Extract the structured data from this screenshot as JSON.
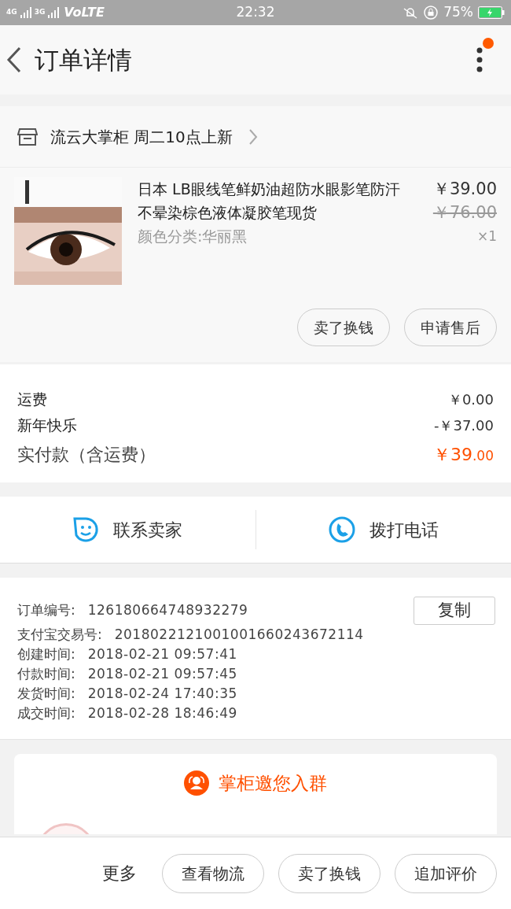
{
  "status_bar": {
    "network_1": "4G",
    "network_2": "3G",
    "volte": "VoLTE",
    "time": "22:32",
    "battery": "75%"
  },
  "header": {
    "title": "订单详情",
    "has_notification": true
  },
  "shop": {
    "name": "流云大掌柜 周二10点上新"
  },
  "product": {
    "title": "日本 LB眼线笔鲜奶油超防水眼影笔防汗不晕染棕色液体凝胶笔现货",
    "variant": "颜色分类:华丽黑",
    "price": "￥39.00",
    "original_price": "￥76.00",
    "quantity": "×1"
  },
  "product_actions": [
    "卖了换钱",
    "申请售后"
  ],
  "fees": [
    {
      "label": "运费",
      "value": "￥0.00",
      "kind": "normal"
    },
    {
      "label": "新年快乐",
      "value": "-￥37.00",
      "kind": "normal"
    },
    {
      "label": "实付款（含运费）",
      "value": "￥39",
      "value_cents": ".00",
      "kind": "total"
    }
  ],
  "contact": [
    {
      "label": "联系卖家",
      "kind": "chat"
    },
    {
      "label": "拨打电话",
      "kind": "phone"
    }
  ],
  "order_info": [
    {
      "label": "订单编号:",
      "value": "126180664748932279",
      "copy_button": "复制"
    },
    {
      "label": "支付宝交易号:",
      "value": "2018022121001001660243672114"
    },
    {
      "label": "创建时间:",
      "value": "2018-02-21 09:57:41"
    },
    {
      "label": "付款时间:",
      "value": "2018-02-21 09:57:45"
    },
    {
      "label": "发货时间:",
      "value": "2018-02-24 17:40:35"
    },
    {
      "label": "成交时间:",
      "value": "2018-02-28 18:46:49"
    }
  ],
  "group_card": {
    "title": "掌柜邀您入群"
  },
  "bottom_bar": {
    "more": "更多",
    "buttons": [
      "查看物流",
      "卖了换钱",
      "追加评价"
    ]
  }
}
